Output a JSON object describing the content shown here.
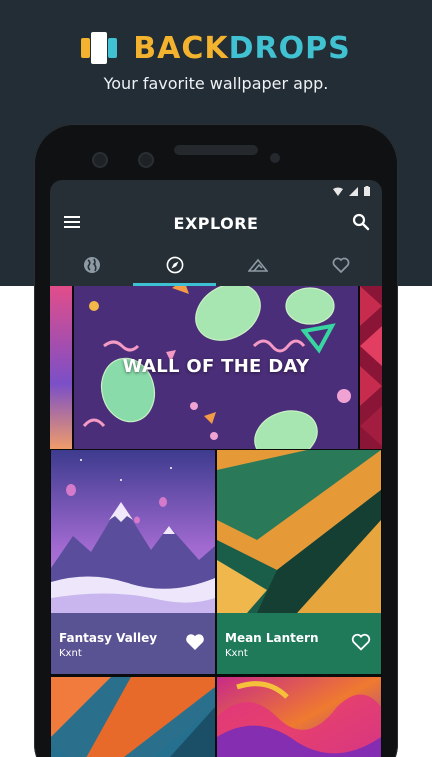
{
  "promo": {
    "brand_part1": "BACK",
    "brand_part2": "DROPS",
    "tagline": "Your favorite wallpaper app."
  },
  "app": {
    "title": "EXPLORE",
    "menu_icon": "hamburger-menu-icon",
    "search_icon": "search-icon",
    "tabs": [
      {
        "icon": "globe-icon",
        "active": false
      },
      {
        "icon": "compass-icon",
        "active": true
      },
      {
        "icon": "mountain-icon",
        "active": false
      },
      {
        "icon": "heart-outline-icon",
        "active": false
      }
    ],
    "accent": "#3ec1d3"
  },
  "wall_of_the_day": {
    "label": "WALL OF THE DAY"
  },
  "wallpapers": [
    {
      "name": "Fantasy Valley",
      "author": "Kxnt",
      "favorited": true,
      "info_color": "#5a5393"
    },
    {
      "name": "Mean Lantern",
      "author": "Kxnt",
      "favorited": false,
      "info_color": "#1f7a5a"
    }
  ],
  "colors": {
    "brand_yellow": "#f4b32e",
    "brand_cyan": "#41c2d3",
    "header_dark": "#232d35"
  }
}
